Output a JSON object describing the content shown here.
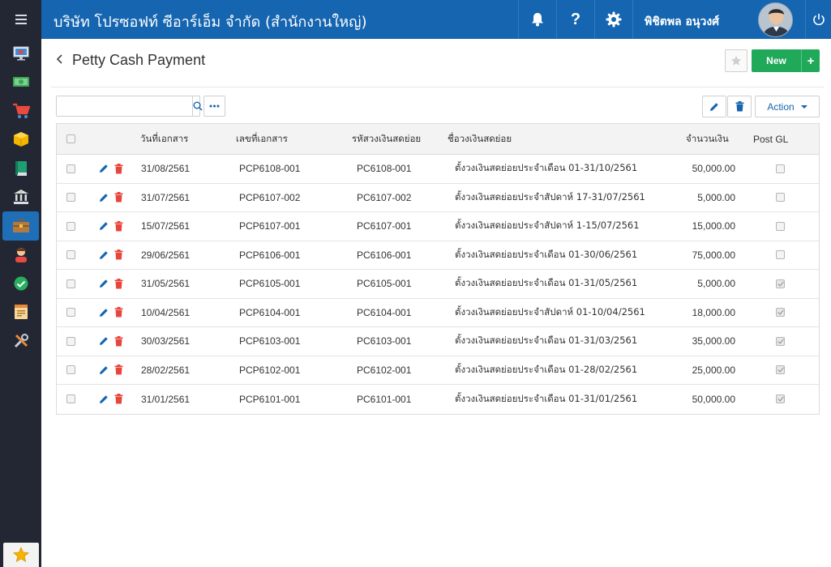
{
  "header": {
    "company": "บริษัท โปรซอฟท์ ซีอาร์เอ็ม จำกัด (สำนักงานใหญ่)",
    "username": "พิชิตพล อนุวงศ์"
  },
  "sidebar": {
    "items": [
      {
        "icon": "monitor-icon"
      },
      {
        "icon": "cash-icon"
      },
      {
        "icon": "cart-icon"
      },
      {
        "icon": "box-icon"
      },
      {
        "icon": "book-icon"
      },
      {
        "icon": "bank-icon"
      },
      {
        "icon": "briefcase-icon",
        "active": true
      },
      {
        "icon": "person-icon"
      },
      {
        "icon": "check-circle-icon"
      },
      {
        "icon": "document-icon"
      },
      {
        "icon": "tools-icon"
      }
    ]
  },
  "page": {
    "title": "Petty Cash Payment",
    "new_label": "New",
    "new_plus": "+",
    "action_label": "Action"
  },
  "search": {
    "value": "",
    "placeholder": ""
  },
  "table": {
    "columns": {
      "date": "วันที่เอกสาร",
      "doc_no": "เลขที่เอกสาร",
      "code": "รหัสวงเงินสดย่อย",
      "name": "ชื่อวงเงินสดย่อย",
      "amount": "จำนวนเงิน",
      "post_gl": "Post GL"
    },
    "rows": [
      {
        "date": "31/08/2561",
        "doc_no": "PCP6108-001",
        "code": "PC6108-001",
        "name": "ตั้งวงเงินสดย่อยประจำเดือน 01-31/10/2561",
        "amount": "50,000.00",
        "post_gl": false
      },
      {
        "date": "31/07/2561",
        "doc_no": "PCP6107-002",
        "code": "PC6107-002",
        "name": "ตั้งวงเงินสดย่อยประจำสัปดาห์ 17-31/07/2561",
        "amount": "5,000.00",
        "post_gl": false
      },
      {
        "date": "15/07/2561",
        "doc_no": "PCP6107-001",
        "code": "PC6107-001",
        "name": "ตั้งวงเงินสดย่อยประจำสัปดาห์ 1-15/07/2561",
        "amount": "15,000.00",
        "post_gl": false
      },
      {
        "date": "29/06/2561",
        "doc_no": "PCP6106-001",
        "code": "PC6106-001",
        "name": "ตั้งวงเงินสดย่อยประจำเดือน 01-30/06/2561",
        "amount": "75,000.00",
        "post_gl": false
      },
      {
        "date": "31/05/2561",
        "doc_no": "PCP6105-001",
        "code": "PC6105-001",
        "name": "ตั้งวงเงินสดย่อยประจำเดือน 01-31/05/2561",
        "amount": "5,000.00",
        "post_gl": true
      },
      {
        "date": "10/04/2561",
        "doc_no": "PCP6104-001",
        "code": "PC6104-001",
        "name": "ตั้งวงเงินสดย่อยประจำสัปดาห์ 01-10/04/2561",
        "amount": "18,000.00",
        "post_gl": true
      },
      {
        "date": "30/03/2561",
        "doc_no": "PCP6103-001",
        "code": "PC6103-001",
        "name": "ตั้งวงเงินสดย่อยประจำเดือน 01-31/03/2561",
        "amount": "35,000.00",
        "post_gl": true
      },
      {
        "date": "28/02/2561",
        "doc_no": "PCP6102-001",
        "code": "PC6102-001",
        "name": "ตั้งวงเงินสดย่อยประจำเดือน 01-28/02/2561",
        "amount": "25,000.00",
        "post_gl": true
      },
      {
        "date": "31/01/2561",
        "doc_no": "PCP6101-001",
        "code": "PC6101-001",
        "name": "ตั้งวงเงินสดย่อยประจำเดือน 01-31/01/2561",
        "amount": "50,000.00",
        "post_gl": true
      }
    ]
  },
  "colors": {
    "topbar": "#1565b0",
    "sidebar": "#232733",
    "new_button": "#21a95a",
    "edit_icon": "#1565b0",
    "delete_icon": "#e8453c"
  }
}
